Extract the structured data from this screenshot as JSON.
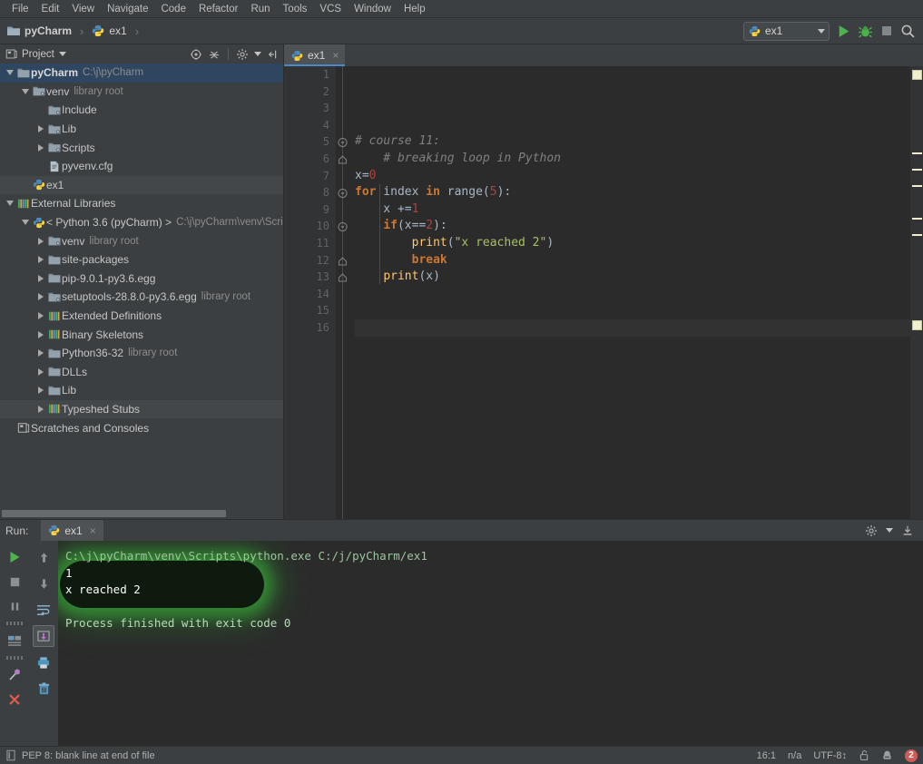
{
  "menu": {
    "items": [
      "File",
      "Edit",
      "View",
      "Navigate",
      "Code",
      "Refactor",
      "Run",
      "Tools",
      "VCS",
      "Window",
      "Help"
    ]
  },
  "toolbar": {
    "breadcrumb_project": "pyCharm",
    "breadcrumb_file": "ex1",
    "run_config": "ex1",
    "run_tooltip": "Run",
    "debug_tooltip": "Debug",
    "stop_tooltip": "Stop",
    "search_tooltip": "Search Everywhere"
  },
  "project_panel": {
    "title": "Project",
    "icons": [
      "locate-icon",
      "collapse-all-icon",
      "settings-icon",
      "hide-icon"
    ],
    "tree": [
      {
        "label": "pyCharm",
        "sub": "C:\\j\\pyCharm",
        "depth": 0,
        "arrow": "down",
        "icon": "folder",
        "bold": true,
        "state": "selected"
      },
      {
        "label": "venv",
        "sub": "library root",
        "depth": 1,
        "arrow": "down",
        "icon": "folder-module",
        "bold": false,
        "state": ""
      },
      {
        "label": "Include",
        "sub": "",
        "depth": 2,
        "arrow": "none",
        "icon": "folder-module",
        "bold": false,
        "state": ""
      },
      {
        "label": "Lib",
        "sub": "",
        "depth": 2,
        "arrow": "right",
        "icon": "folder-module",
        "bold": false,
        "state": ""
      },
      {
        "label": "Scripts",
        "sub": "",
        "depth": 2,
        "arrow": "right",
        "icon": "folder-module",
        "bold": false,
        "state": ""
      },
      {
        "label": "pyvenv.cfg",
        "sub": "",
        "depth": 2,
        "arrow": "none",
        "icon": "file-cfg",
        "bold": false,
        "state": ""
      },
      {
        "label": "ex1",
        "sub": "",
        "depth": 1,
        "arrow": "none",
        "icon": "python-file",
        "bold": false,
        "state": "highlight"
      },
      {
        "label": "External Libraries",
        "sub": "",
        "depth": 0,
        "arrow": "down",
        "icon": "library",
        "bold": false,
        "state": ""
      },
      {
        "label": "< Python 3.6 (pyCharm) >",
        "sub": "C:\\j\\pyCharm\\venv\\Scrip",
        "depth": 1,
        "arrow": "down",
        "icon": "python",
        "bold": false,
        "state": ""
      },
      {
        "label": "venv",
        "sub": "library root",
        "depth": 2,
        "arrow": "right",
        "icon": "folder-module",
        "bold": false,
        "state": ""
      },
      {
        "label": "site-packages",
        "sub": "",
        "depth": 2,
        "arrow": "right",
        "icon": "folder",
        "bold": false,
        "state": ""
      },
      {
        "label": "pip-9.0.1-py3.6.egg",
        "sub": "",
        "depth": 2,
        "arrow": "right",
        "icon": "folder",
        "bold": false,
        "state": ""
      },
      {
        "label": "setuptools-28.8.0-py3.6.egg",
        "sub": "library root",
        "depth": 2,
        "arrow": "right",
        "icon": "folder-module",
        "bold": false,
        "state": ""
      },
      {
        "label": "Extended Definitions",
        "sub": "",
        "depth": 2,
        "arrow": "right",
        "icon": "library",
        "bold": false,
        "state": ""
      },
      {
        "label": "Binary Skeletons",
        "sub": "",
        "depth": 2,
        "arrow": "right",
        "icon": "library",
        "bold": false,
        "state": ""
      },
      {
        "label": "Python36-32",
        "sub": "library root",
        "depth": 2,
        "arrow": "right",
        "icon": "folder",
        "bold": false,
        "state": ""
      },
      {
        "label": "DLLs",
        "sub": "",
        "depth": 2,
        "arrow": "right",
        "icon": "folder",
        "bold": false,
        "state": ""
      },
      {
        "label": "Lib",
        "sub": "",
        "depth": 2,
        "arrow": "right",
        "icon": "folder",
        "bold": false,
        "state": ""
      },
      {
        "label": "Typeshed Stubs",
        "sub": "",
        "depth": 2,
        "arrow": "right",
        "icon": "library",
        "bold": false,
        "state": "highlight"
      },
      {
        "label": "Scratches and Consoles",
        "sub": "",
        "depth": 0,
        "arrow": "none",
        "icon": "scratches",
        "bold": false,
        "state": ""
      }
    ]
  },
  "editor": {
    "tab": {
      "label": "ex1",
      "close": "×",
      "icon": "python-file"
    },
    "line_numbers": [
      "1",
      "2",
      "3",
      "4",
      "5",
      "6",
      "7",
      "8",
      "9",
      "10",
      "11",
      "12",
      "13",
      "14",
      "15",
      "16"
    ],
    "current_line": 16,
    "lines": [
      {
        "n": 1,
        "tokens": []
      },
      {
        "n": 2,
        "tokens": []
      },
      {
        "n": 3,
        "tokens": []
      },
      {
        "n": 4,
        "tokens": []
      },
      {
        "n": 5,
        "tokens": [
          {
            "t": "# course 11:",
            "c": "cmt"
          }
        ]
      },
      {
        "n": 6,
        "tokens": [
          {
            "t": "    # breaking loop in Python",
            "c": "cmt"
          }
        ]
      },
      {
        "n": 7,
        "tokens": [
          {
            "t": "x",
            "c": "var"
          },
          {
            "t": "=",
            "c": "plain"
          },
          {
            "t": "0",
            "c": "num"
          }
        ]
      },
      {
        "n": 8,
        "tokens": [
          {
            "t": "for",
            "c": "kw"
          },
          {
            "t": " index ",
            "c": "plain"
          },
          {
            "t": "in",
            "c": "kw"
          },
          {
            "t": " ",
            "c": "plain"
          },
          {
            "t": "range",
            "c": "plain"
          },
          {
            "t": "(",
            "c": "plain"
          },
          {
            "t": "5",
            "c": "num"
          },
          {
            "t": "):",
            "c": "plain"
          }
        ]
      },
      {
        "n": 9,
        "tokens": [
          {
            "t": "    x +=",
            "c": "var"
          },
          {
            "t": "1",
            "c": "num"
          }
        ]
      },
      {
        "n": 10,
        "tokens": [
          {
            "t": "    ",
            "c": "plain"
          },
          {
            "t": "if",
            "c": "kw"
          },
          {
            "t": "(x==",
            "c": "plain"
          },
          {
            "t": "2",
            "c": "num"
          },
          {
            "t": "):",
            "c": "plain"
          }
        ]
      },
      {
        "n": 11,
        "tokens": [
          {
            "t": "        ",
            "c": "plain"
          },
          {
            "t": "print",
            "c": "fn"
          },
          {
            "t": "(",
            "c": "plain"
          },
          {
            "t": "\"x reached 2\"",
            "c": "str"
          },
          {
            "t": ")",
            "c": "plain"
          }
        ]
      },
      {
        "n": 12,
        "tokens": [
          {
            "t": "        ",
            "c": "plain"
          },
          {
            "t": "break",
            "c": "kw"
          }
        ]
      },
      {
        "n": 13,
        "tokens": [
          {
            "t": "    ",
            "c": "plain"
          },
          {
            "t": "print",
            "c": "fn"
          },
          {
            "t": "(x)",
            "c": "plain"
          }
        ]
      },
      {
        "n": 14,
        "tokens": []
      },
      {
        "n": 15,
        "tokens": []
      },
      {
        "n": 16,
        "tokens": []
      }
    ],
    "fold_lines": [
      5,
      6,
      8,
      10,
      12,
      13
    ]
  },
  "run_panel": {
    "run_label": "Run:",
    "tab_label": "ex1",
    "tab_close": "×",
    "left_buttons": [
      "rerun-icon",
      "stop-icon",
      "pause-icon",
      "console-icon",
      "pin-icon",
      "close-icon"
    ],
    "right_buttons": [
      "scroll-up-icon",
      "scroll-down-icon",
      "soft-wrap-icon",
      "scroll-to-end-icon",
      "print-icon",
      "trash-icon"
    ],
    "header_buttons": [
      "settings-icon",
      "hide-icon"
    ],
    "console": [
      {
        "text": "C:\\j\\pyCharm\\venv\\Scripts\\python.exe C:/j/pyCharm/ex1",
        "style": "c-cmd"
      },
      {
        "text": "1",
        "style": "c-out"
      },
      {
        "text": "x reached 2",
        "style": "c-out"
      },
      {
        "text": "",
        "style": "c-out"
      },
      {
        "text": "Process finished with exit code 0",
        "style": "c-fin"
      }
    ]
  },
  "status_bar": {
    "message": "PEP 8: blank line at end of file",
    "position": "16:1",
    "line_sep": "n/a",
    "encoding": "UTF-8",
    "lock": "unlocked-icon",
    "inspection": "inspector-icon",
    "error_count": "2"
  },
  "colors": {
    "chrome": "#3c3f41",
    "editor_bg": "#2b2b2b",
    "gutter_bg": "#313335",
    "accent_blue": "#4a88c7",
    "selection": "#2f4661",
    "keyword": "#cc7832",
    "number": "#a9453d",
    "string": "#a5c261",
    "function": "#ffc66d",
    "comment": "#808080",
    "marker_yellow": "#f2f0c8",
    "error_red": "#cf5b56",
    "run_green": "#49a349"
  }
}
